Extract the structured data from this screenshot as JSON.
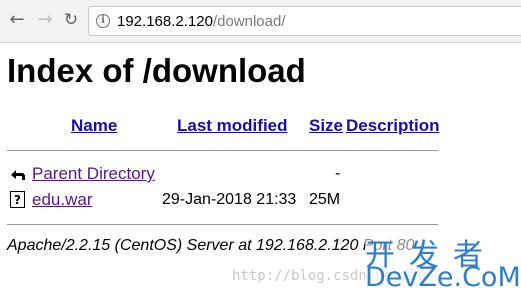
{
  "browser": {
    "back_icon": "arrow-left-icon",
    "forward_icon": "arrow-right-icon",
    "reload_icon": "reload-icon",
    "info_icon": "info-icon",
    "url_host": "192.168.2.120",
    "url_path": "/download/"
  },
  "page": {
    "title": "Index of /download",
    "columns": {
      "name": "Name",
      "last_modified": "Last modified",
      "size": "Size",
      "description": "Description"
    },
    "rows": [
      {
        "icon": "back-folder-icon",
        "name": "Parent Directory",
        "last_modified": "",
        "size": "-",
        "description": ""
      },
      {
        "icon": "unknown-file-icon",
        "name": "edu.war",
        "last_modified": "29-Jan-2018 21:33",
        "size": "25M",
        "description": ""
      }
    ],
    "address": "Apache/2.2.15 (CentOS) Server at 192.168.2.120 Port 80"
  },
  "watermark": {
    "blog_url": "http://blog.csdn.net/lu",
    "logo_cn": "开发者",
    "logo_en": "DevZe.CoM"
  }
}
